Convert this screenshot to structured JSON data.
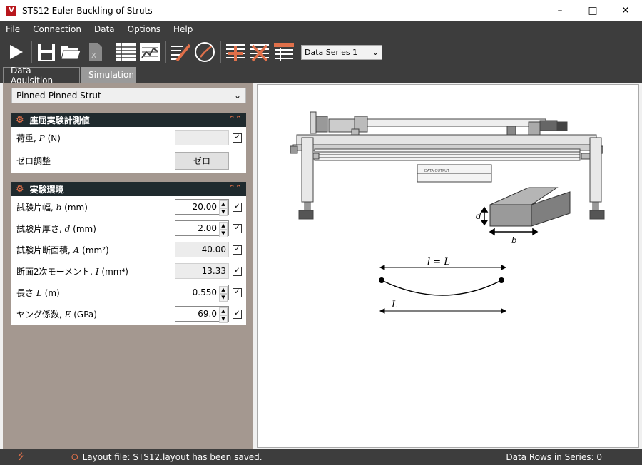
{
  "window": {
    "title": "STS12 Euler Buckling of Struts",
    "app_icon": "V"
  },
  "menu": [
    "File",
    "Connection",
    "Data",
    "Options",
    "Help"
  ],
  "toolbar": {
    "series_select": "Data Series 1"
  },
  "tabs": [
    "Data Aquisition",
    "Simulation"
  ],
  "left": {
    "strut_select": "Pinned-Pinned Strut",
    "measurement": {
      "title": "座屈実験計測値",
      "load_label": "荷重,",
      "load_sym": "P",
      "load_unit": "(N)",
      "load_value": "--",
      "zero_label": "ゼロ調整",
      "zero_button": "ゼロ"
    },
    "environment": {
      "title": "実験環境",
      "rows": [
        {
          "label": "試験片幅,",
          "sym": "b",
          "unit": "(mm)",
          "value": "20.00"
        },
        {
          "label": "試験片厚さ,",
          "sym": "d",
          "unit": "(mm)",
          "value": "2.00"
        },
        {
          "label": "試験片断面積,",
          "sym": "A",
          "unit": "(mm²)",
          "value": "40.00"
        },
        {
          "label": "断面2次モーメント,",
          "sym": "I",
          "unit": "(mm⁴)",
          "value": "13.33"
        },
        {
          "label": "長さ",
          "sym": "L",
          "unit": "(m)",
          "value": "0.550"
        },
        {
          "label": "ヤング係数,",
          "sym": "E",
          "unit": "(GPa)",
          "value": "69.0"
        }
      ]
    }
  },
  "diagram": {
    "d_label": "d",
    "b_label": "b",
    "span_label": "l = L",
    "length_label": "L",
    "device_text": "DATA OUTPUT"
  },
  "status": {
    "message": "Layout file: STS12.layout has been saved.",
    "rows": "Data Rows in Series: 0"
  }
}
